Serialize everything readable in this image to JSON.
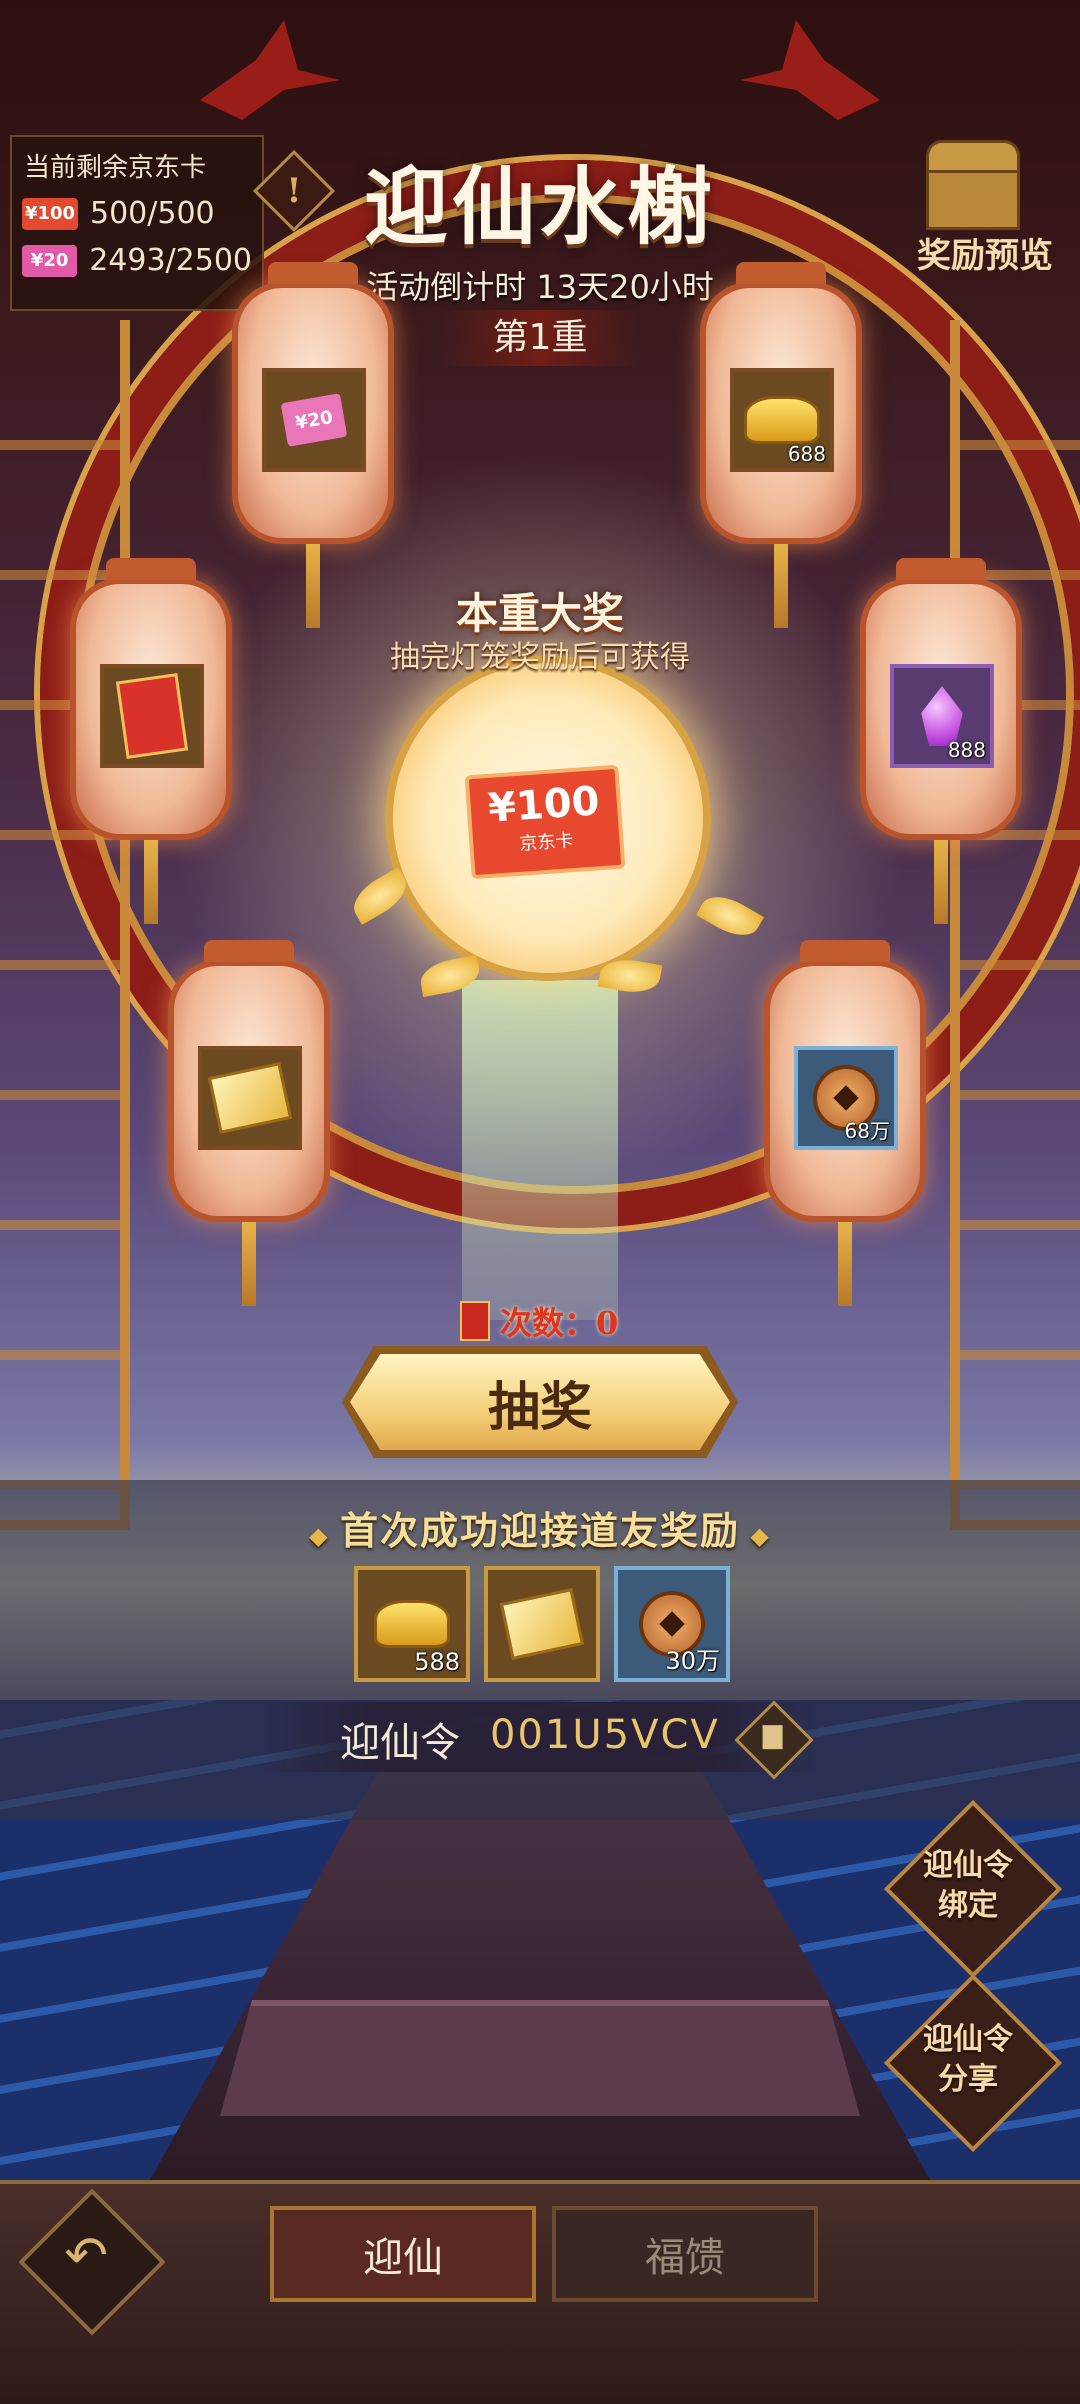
{
  "stock": {
    "title": "当前剩余京东卡",
    "cards": [
      {
        "tag": "¥100",
        "value": "500/500"
      },
      {
        "tag": "¥20",
        "value": "2493/2500"
      }
    ]
  },
  "header": {
    "info_glyph": "!",
    "title": "迎仙水榭",
    "countdown": "活动倒计时 13天20小时",
    "tier": "第1重"
  },
  "preview": {
    "label": "奖励预览"
  },
  "lanterns": [
    {
      "item": "京东卡¥20",
      "tag": "¥20",
      "qty": ""
    },
    {
      "item": "元宝",
      "qty": "688"
    },
    {
      "item": "红包",
      "qty": ""
    },
    {
      "item": "紫晶",
      "qty": "888"
    },
    {
      "item": "金票",
      "qty": ""
    },
    {
      "item": "铜钱",
      "qty": "68万"
    }
  ],
  "grand": {
    "title": "本重大奖",
    "subtitle": "抽完灯笼奖励后可获得",
    "card_amount": "¥100",
    "card_name": "京东卡"
  },
  "draw": {
    "count_label": "次数：0",
    "button_label": "抽奖"
  },
  "first_reward": {
    "title": "首次成功迎接道友奖励",
    "items": [
      {
        "item": "元宝",
        "qty": "588"
      },
      {
        "item": "金票",
        "qty": ""
      },
      {
        "item": "铜钱",
        "qty": "30万"
      }
    ]
  },
  "code": {
    "label": "迎仙令",
    "value": "001U5VCV"
  },
  "side_buttons": {
    "bind": "迎仙令\n绑定",
    "share": "迎仙令\n分享",
    "bind_l1": "迎仙令",
    "bind_l2": "绑定",
    "share_l1": "迎仙令",
    "share_l2": "分享"
  },
  "bottom": {
    "back_glyph": "↶",
    "tabs": [
      {
        "label": "迎仙"
      },
      {
        "label": "福馈"
      }
    ]
  },
  "colors": {
    "accent_gold": "#e8c46a",
    "lantern_red": "#b8542c",
    "count_red": "#e0341c"
  }
}
